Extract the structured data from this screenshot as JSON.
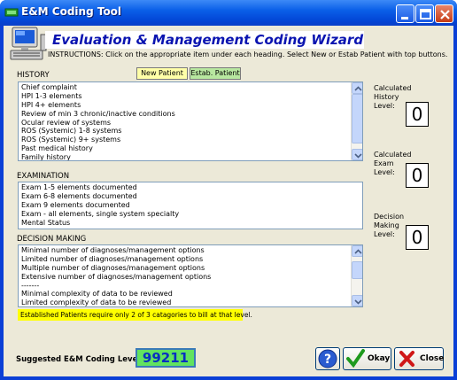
{
  "window": {
    "title": "E&M Coding Tool",
    "accent": "#0a5fe8"
  },
  "banner": {
    "title": "Evaluation & Management Coding Wizard",
    "instructions": "INSTRUCTIONS:  Click on the appropriate item under each heading. Select New or Estab Patient with top buttons."
  },
  "patient_buttons": {
    "new_label": "New Patient",
    "estab_label": "Estab. Patient"
  },
  "history": {
    "heading": "HISTORY",
    "items": [
      "Chief complaint",
      "HPI 1-3 elements",
      "HPI 4+ elements",
      "Review of min 3 chronic/inactive conditions",
      "Ocular review of systems",
      "ROS (Systemic) 1-8 systems",
      "ROS (Systemic) 9+ systems",
      "Past medical  history",
      "Family history"
    ]
  },
  "examination": {
    "heading": "EXAMINATION",
    "items": [
      "Exam 1-5 elements documented",
      "Exam 6-8 elements documented",
      "Exam 9 elements documented",
      "Exam - all elements, single system specialty",
      "Mental Status"
    ]
  },
  "decision": {
    "heading": "DECISION MAKING",
    "items": [
      "Minimal number of diagnoses/management options",
      "Limited number of diagnoses/management options",
      "Multiple number of diagnoses/management options",
      "Extensive number of diagnoses/management options",
      "-------",
      "Minimal complexity of data to be reviewed",
      "Limited complexity of data to be reviewed"
    ]
  },
  "calculated": {
    "history_label_1": "Calculated",
    "history_label_2": "History",
    "history_label_3": "Level:",
    "history_value": "0",
    "exam_label_1": "Calculated",
    "exam_label_2": "Exam",
    "exam_label_3": "Level:",
    "exam_value": "0",
    "decision_label_1": "Decision",
    "decision_label_2": "Making",
    "decision_label_3": "Level:",
    "decision_value": "0"
  },
  "notice": "Established Patients require only 2 of 3 catagories to bill at that level.",
  "suggested": {
    "label": "Suggested E&M Coding Level:",
    "value": "99211",
    "color": "#62e35f"
  },
  "actions": {
    "okay_label": "Okay",
    "close_label": "Close"
  }
}
